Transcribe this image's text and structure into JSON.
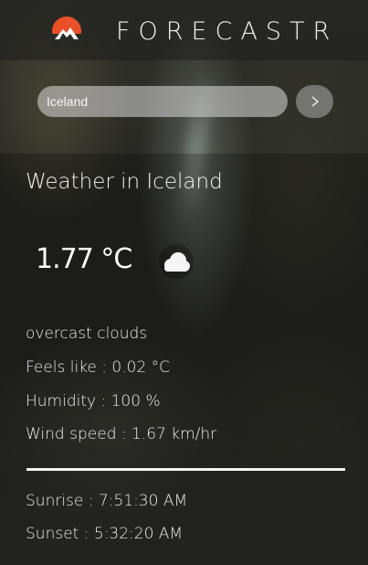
{
  "header": {
    "brand": "FORECASTR",
    "logo_icon": "mountain-sun-icon",
    "logo_colors": {
      "sun": "#e9502a",
      "mountain": "#ffffff"
    }
  },
  "search": {
    "value": "Iceland",
    "placeholder": "Iceland",
    "submit_icon": "chevron-right-icon"
  },
  "weather": {
    "title": "Weather in Iceland",
    "temperature": "1.77 °C",
    "condition_icon": "cloud-icon",
    "description": "overcast clouds",
    "feels_like": "Feels like : 0.02 °C",
    "humidity": "Humidity : 100 %",
    "wind": "Wind speed : 1.67 km/hr",
    "sunrise": "Sunrise : 7:51:30 AM",
    "sunset": "Sunset : 5:32:20 AM"
  }
}
